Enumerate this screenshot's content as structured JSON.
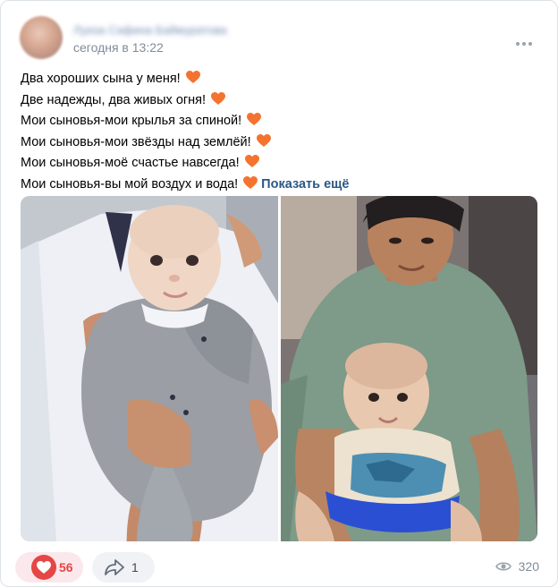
{
  "post": {
    "author_name": "Луиза Сафина Баймуратова",
    "timestamp": "сегодня в 13:22",
    "more_icon": "more-horizontal-icon",
    "text_lines": [
      "Два хороших сына у меня!",
      "Две надежды, два живых огня!",
      "Мои сыновья-мои крылья за спиной!",
      "Мои сыновья-мои звёзды над землёй!",
      "Мои сыновья-моё счастье навсегда!",
      "Мои сыновья-вы мой воздух и вода!"
    ],
    "show_more_label": "Показать ещё",
    "emoji": "orange-heart",
    "photos": [
      {
        "name": "photo-baby-held-by-man"
      },
      {
        "name": "photo-teen-with-baby"
      }
    ]
  },
  "footer": {
    "likes": "56",
    "shares": "1",
    "views": "320"
  },
  "colors": {
    "link": "#2a5885",
    "like_red": "#e64646",
    "muted": "#818c99",
    "heart_orange": "#f4732f"
  }
}
